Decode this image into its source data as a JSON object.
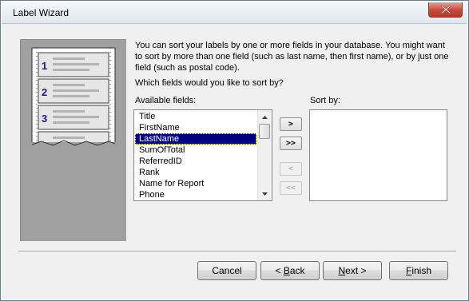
{
  "window": {
    "title": "Label Wizard"
  },
  "illustration": {
    "labels": [
      "1",
      "2",
      "3"
    ]
  },
  "content": {
    "description": "You can sort your labels by one or more fields in your database.  You might want to sort by more than one field (such as last name, then first name), or by just one field (such as postal code).",
    "question": "Which fields would you like to sort by?",
    "available_label": "Available fields:",
    "sort_label": "Sort by:"
  },
  "available_fields": [
    "Title",
    "FirstName",
    "LastName",
    "SumOfTotal",
    "ReferredID",
    "Rank",
    "Name for Report",
    "Phone"
  ],
  "selected_field": "LastName",
  "move_buttons": {
    "add_one": ">",
    "add_all": ">>",
    "remove_one": "<",
    "remove_all": "<<"
  },
  "buttons": {
    "cancel": "Cancel",
    "back_prefix": "< ",
    "back_key": "B",
    "back_rest": "ack",
    "next_key": "N",
    "next_rest": "ext >",
    "finish_key": "F",
    "finish_rest": "inish"
  }
}
